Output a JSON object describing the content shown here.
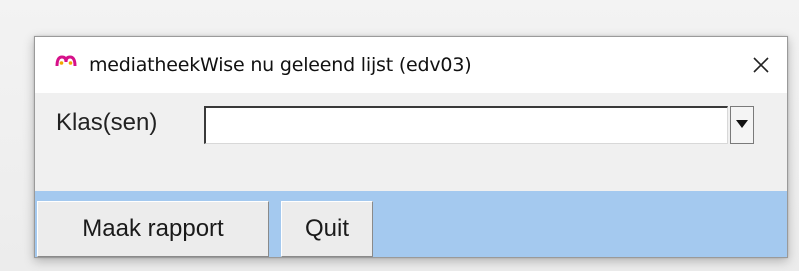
{
  "window": {
    "title": "mediatheekWise nu geleend lijst (edv03)",
    "icon": "mediatheekwise-logo-icon",
    "close_icon": "close-icon",
    "icon_color": "#d6118a"
  },
  "form": {
    "klas_label": "Klas(sen)",
    "klas_value": "",
    "dropdown_icon": "dropdown-arrow-icon"
  },
  "buttons": {
    "maak_rapport": "Maak rapport",
    "quit": "Quit"
  },
  "colors": {
    "content_bg": "#f0f0f0",
    "button_bar_bg": "#a4c9ef"
  }
}
